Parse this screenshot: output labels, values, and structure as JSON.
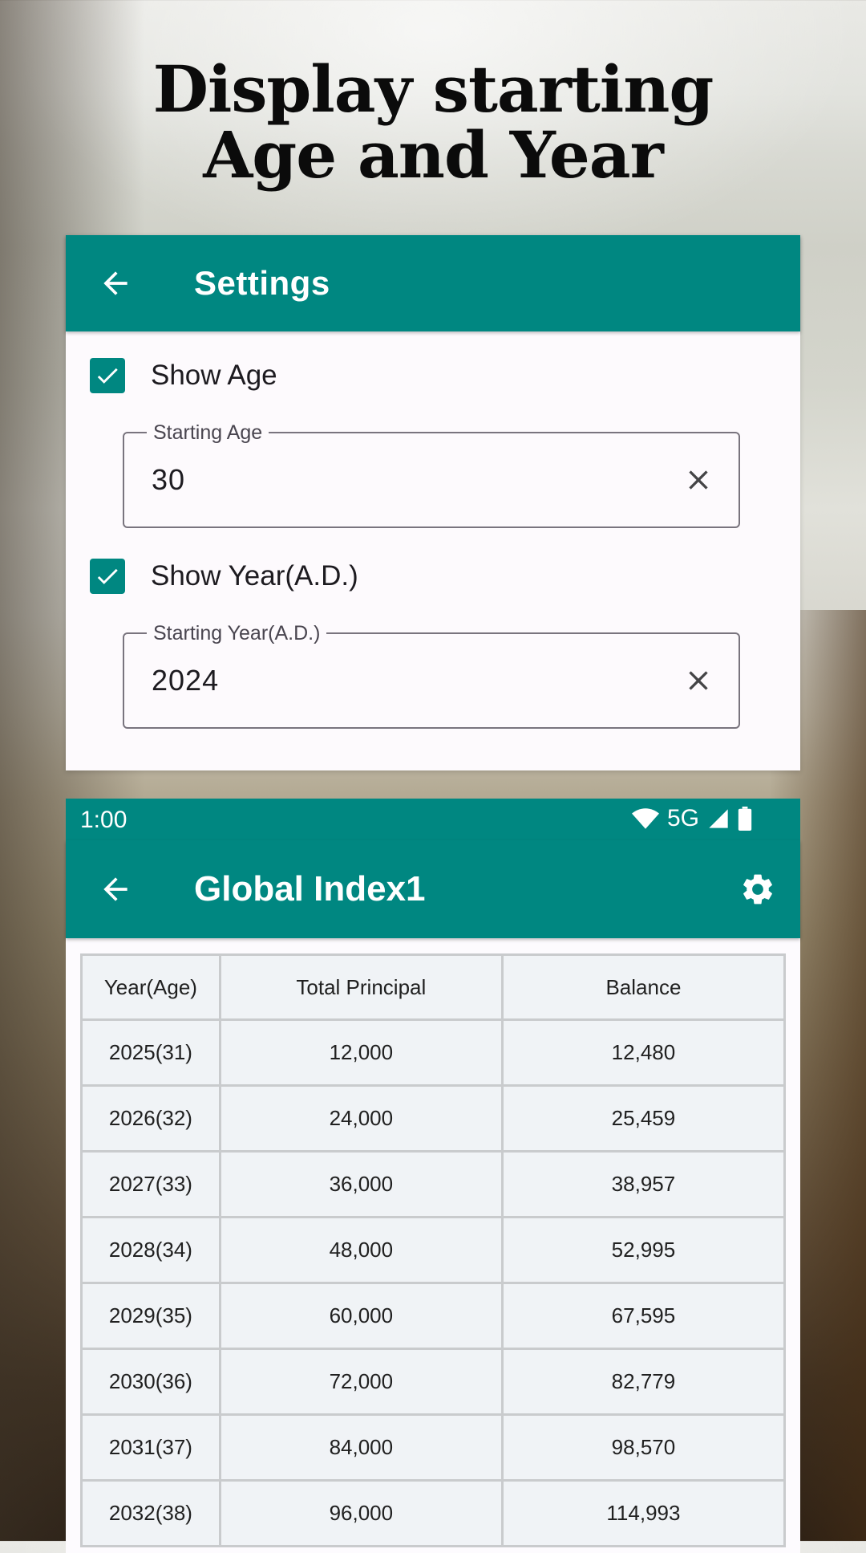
{
  "headline": {
    "line1": "Display starting",
    "line2": "Age and Year"
  },
  "settings_screen": {
    "title": "Settings",
    "show_age": {
      "label": "Show Age",
      "checked": true
    },
    "starting_age": {
      "label": "Starting Age",
      "value": "30"
    },
    "show_year": {
      "label": "Show Year(A.D.)",
      "checked": true
    },
    "starting_year": {
      "label": "Starting Year(A.D.)",
      "value": "2024"
    }
  },
  "status_bar": {
    "time": "1:00",
    "network": "5G"
  },
  "table_screen": {
    "title": "Global Index1",
    "columns": [
      "Year(Age)",
      "Total Principal",
      "Balance"
    ],
    "rows": [
      [
        "2025(31)",
        "12,000",
        "12,480"
      ],
      [
        "2026(32)",
        "24,000",
        "25,459"
      ],
      [
        "2027(33)",
        "36,000",
        "38,957"
      ],
      [
        "2028(34)",
        "48,000",
        "52,995"
      ],
      [
        "2029(35)",
        "60,000",
        "67,595"
      ],
      [
        "2030(36)",
        "72,000",
        "82,779"
      ],
      [
        "2031(37)",
        "84,000",
        "98,570"
      ],
      [
        "2032(38)",
        "96,000",
        "114,993"
      ]
    ]
  },
  "colors": {
    "teal_primary": "#008781",
    "table_background": "#f0f3f6"
  }
}
